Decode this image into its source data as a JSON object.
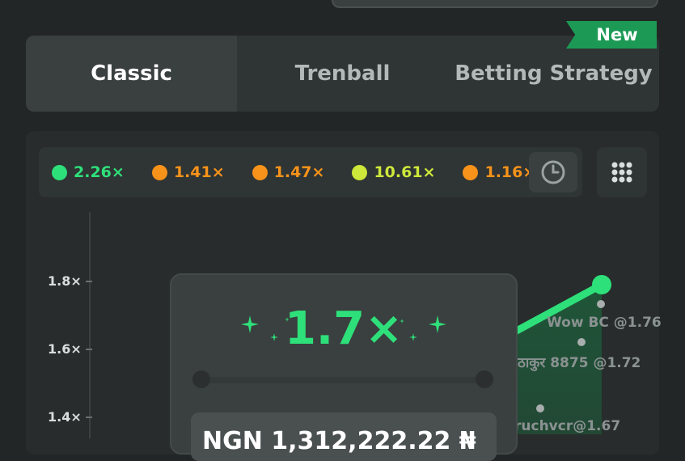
{
  "tabs": [
    {
      "label": "Classic",
      "active": true
    },
    {
      "label": "Trenball",
      "active": false
    },
    {
      "label": "Betting Strategy",
      "active": false
    }
  ],
  "new_badge": "New",
  "history": [
    {
      "value": "2.26×",
      "color": "#2ee07a"
    },
    {
      "value": "1.41×",
      "color": "#f7931a"
    },
    {
      "value": "1.47×",
      "color": "#f7931a"
    },
    {
      "value": "10.61×",
      "color": "#cde83a"
    },
    {
      "value": "1.16×",
      "color": "#f7931a"
    }
  ],
  "y_ticks": [
    "1.8×",
    "1.6×",
    "1.4×"
  ],
  "players": [
    {
      "label": "Wow BC @1.76"
    },
    {
      "label": "ठाकुर 8875 @1.72"
    },
    {
      "label": "ruchvcr@1.67"
    }
  ],
  "multiplier": "1.7×",
  "payout": "NGN 1,312,222.22 ₦",
  "colors": {
    "accent": "#2ee07a",
    "orange": "#f7931a",
    "lime": "#cde83a"
  }
}
